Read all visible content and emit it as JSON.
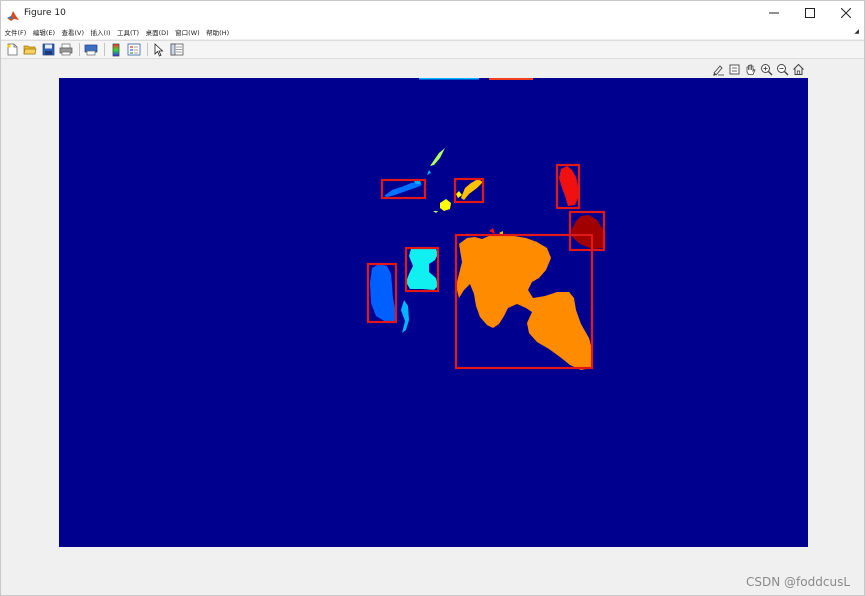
{
  "window": {
    "title": "Figure 10",
    "controls": {
      "minimize": "—",
      "maximize": "☐",
      "close": "✕"
    }
  },
  "menu": {
    "items": [
      "文件(F)",
      "编辑(E)",
      "查看(V)",
      "插入(I)",
      "工具(T)",
      "桌面(D)",
      "窗口(W)",
      "帮助(H)"
    ],
    "overflow_arrow": "◢"
  },
  "toolbar": {
    "buttons": [
      "new-figure-icon",
      "open-file-icon",
      "save-icon",
      "print-icon",
      "print-preview-icon",
      "colorbar-icon",
      "legend-icon",
      "pointer-icon",
      "property-inspector-icon"
    ]
  },
  "axes_toolbar": {
    "buttons": [
      "brush-icon",
      "data-tip-icon",
      "pan-icon",
      "zoom-in-icon",
      "zoom-out-icon",
      "home-icon"
    ]
  },
  "colors": {
    "background": "#00008f",
    "blue": "#0060ff",
    "light_blue": "#00b4ff",
    "cyan": "#10f0f0",
    "light_green": "#b0ff60",
    "yellow": "#ffff00",
    "gold": "#ffc000",
    "orange": "#ff8c00",
    "red": "#f01010",
    "dark_red": "#a00000",
    "box": "#e01818"
  },
  "watermark": "CSDN @foddcusL"
}
